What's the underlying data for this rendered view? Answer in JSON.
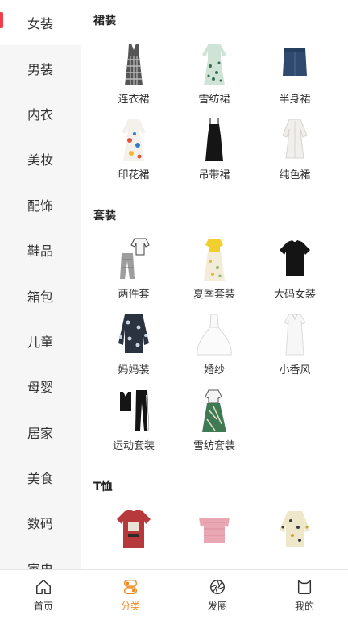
{
  "sidebar": {
    "items": [
      {
        "label": "女装"
      },
      {
        "label": "男装"
      },
      {
        "label": "内衣"
      },
      {
        "label": "美妆"
      },
      {
        "label": "配饰"
      },
      {
        "label": "鞋品"
      },
      {
        "label": "箱包"
      },
      {
        "label": "儿童"
      },
      {
        "label": "母婴"
      },
      {
        "label": "居家"
      },
      {
        "label": "美食"
      },
      {
        "label": "数码"
      },
      {
        "label": "家电"
      }
    ],
    "active_color": "#f23b4b"
  },
  "sections": [
    {
      "title": "裙装",
      "items": [
        {
          "label": "连衣裙",
          "icon": "gingham-dress-icon"
        },
        {
          "label": "雪纺裙",
          "icon": "floral-chiffon-dress-icon"
        },
        {
          "label": "半身裙",
          "icon": "denim-skirt-icon"
        },
        {
          "label": "印花裙",
          "icon": "print-dress-icon"
        },
        {
          "label": "吊带裙",
          "icon": "slip-dress-icon"
        },
        {
          "label": "纯色裙",
          "icon": "shirt-dress-icon"
        }
      ]
    },
    {
      "title": "套装",
      "items": [
        {
          "label": "两件套",
          "icon": "two-piece-set-icon"
        },
        {
          "label": "夏季套装",
          "icon": "summer-set-icon"
        },
        {
          "label": "大码女装",
          "icon": "black-tee-icon"
        },
        {
          "label": "妈妈装",
          "icon": "floral-cardigan-icon"
        },
        {
          "label": "婚纱",
          "icon": "wedding-dress-icon"
        },
        {
          "label": "小香风",
          "icon": "white-shift-dress-icon"
        },
        {
          "label": "运动套装",
          "icon": "sport-set-icon"
        },
        {
          "label": "雪纺套装",
          "icon": "chiffon-set-icon"
        }
      ]
    },
    {
      "title": "T恤",
      "items": [
        {
          "label": "",
          "icon": "red-graphic-tee-icon"
        },
        {
          "label": "",
          "icon": "pink-offshoulder-top-icon"
        },
        {
          "label": "",
          "icon": "floral-blouse-icon"
        }
      ]
    }
  ],
  "tabbar": {
    "items": [
      {
        "label": "首页",
        "icon": "home-icon"
      },
      {
        "label": "分类",
        "icon": "category-icon"
      },
      {
        "label": "发圈",
        "icon": "aperture-icon"
      },
      {
        "label": "我的",
        "icon": "profile-icon"
      }
    ],
    "active_color": "#f08a24"
  }
}
